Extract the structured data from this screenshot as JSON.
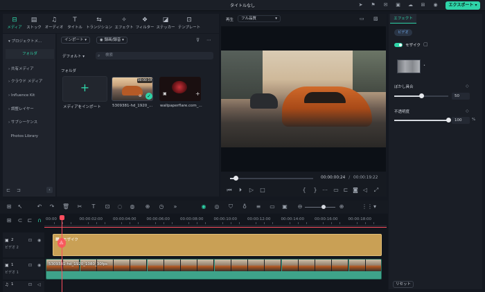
{
  "window": {
    "title": "タイトルなし",
    "export_label": "エクスポート"
  },
  "tabs": [
    {
      "label": "メディア",
      "icon": "media-icon"
    },
    {
      "label": "ストック",
      "icon": "stock-icon"
    },
    {
      "label": "オーディオ",
      "icon": "audio-icon"
    },
    {
      "label": "タイトル",
      "icon": "title-icon"
    },
    {
      "label": "トランジション",
      "icon": "transition-icon"
    },
    {
      "label": "エフェクト",
      "icon": "effect-icon"
    },
    {
      "label": "フィルター",
      "icon": "filter-icon"
    },
    {
      "label": "ステッカー",
      "icon": "sticker-icon"
    },
    {
      "label": "テンプレート",
      "icon": "template-icon"
    }
  ],
  "sidebar": {
    "items": [
      {
        "label": "プロジェクトメ..."
      },
      {
        "label": "フォルダ"
      },
      {
        "label": "共有メディア"
      },
      {
        "label": "クラウド メディア"
      },
      {
        "label": "Influence Kit"
      },
      {
        "label": "調整レイヤー"
      },
      {
        "label": "サブシーケンス"
      },
      {
        "label": "Photos Library"
      }
    ]
  },
  "media": {
    "import_label": "インポート",
    "record_label": "録画/録音",
    "sort_label": "デフォルト",
    "search_placeholder": "検索",
    "folder_label": "フォルダ",
    "import_tile_label": "メディアをインポート",
    "items": [
      {
        "name": "5309381-hd_1920_...",
        "duration": "00:00:19"
      },
      {
        "name": "wallpaperflare.com_..."
      }
    ]
  },
  "preview": {
    "label": "再生",
    "quality": "フル品質",
    "current_time": "00:00:00:24",
    "separator": "/",
    "total_time": "00:00:19:22",
    "progress": 0.07
  },
  "effects_panel": {
    "tab_label": "エフェクト",
    "sub_tab": "ビデオ",
    "effect_name": "モザイク",
    "effect_enabled": true,
    "blur_label": "ぼかし具合",
    "blur_value": "50",
    "blur_fraction": 0.5,
    "opacity_label": "不透明度",
    "opacity_value": "100",
    "opacity_unit": "%",
    "opacity_fraction": 1.0,
    "reset_label": "リセット"
  },
  "timeline": {
    "ticks": [
      "00:00",
      "00:00:02:00",
      "00:00:04:00",
      "00:00:06:00",
      "00:00:08:00",
      "00:00:10:00",
      "00:00:12:00",
      "00:00:14:00",
      "00:00:16:00",
      "00:00:18:00"
    ],
    "tracks": [
      {
        "number": "2",
        "name": "ビデオ 2",
        "clip_label": "モザイク"
      },
      {
        "number": "1",
        "name": "ビデオ 1",
        "clip_label": "5309381-hd_1920_1080_30fps"
      },
      {
        "number": "1",
        "name": ""
      }
    ]
  },
  "colors": {
    "accent": "#2fd4a8",
    "effect_clip": "#c9a055",
    "video_clip": "#3ea38a",
    "playhead": "#ff4d5e"
  }
}
